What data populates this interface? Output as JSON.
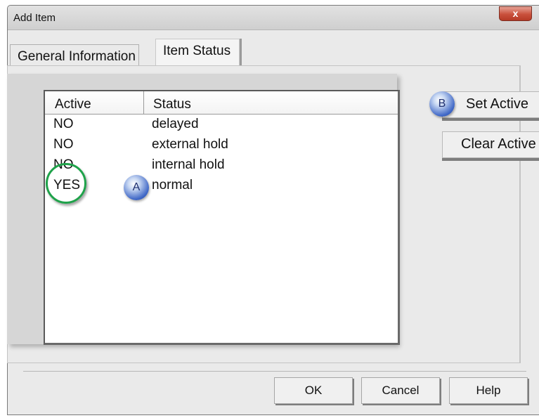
{
  "window": {
    "title": "Add Item",
    "close_label": "x"
  },
  "tabs": [
    {
      "label": "General Information"
    },
    {
      "label": "Item Status"
    }
  ],
  "list": {
    "columns": [
      "Active",
      "Status"
    ],
    "rows": [
      {
        "active": "NO",
        "status": "delayed"
      },
      {
        "active": "NO",
        "status": "external hold"
      },
      {
        "active": "NO",
        "status": "internal hold"
      },
      {
        "active": "YES",
        "status": "normal"
      }
    ]
  },
  "side_buttons": {
    "set_active": "Set Active",
    "clear_active": "Clear Active"
  },
  "callouts": {
    "a": "A",
    "b": "B"
  },
  "footer_buttons": {
    "ok": "OK",
    "cancel": "Cancel",
    "help": "Help"
  },
  "colors": {
    "highlight_ring": "#1fa24a",
    "close_button": "#c9503c",
    "callout": "#3f67c6"
  },
  "icons": {
    "close": "close-icon"
  }
}
